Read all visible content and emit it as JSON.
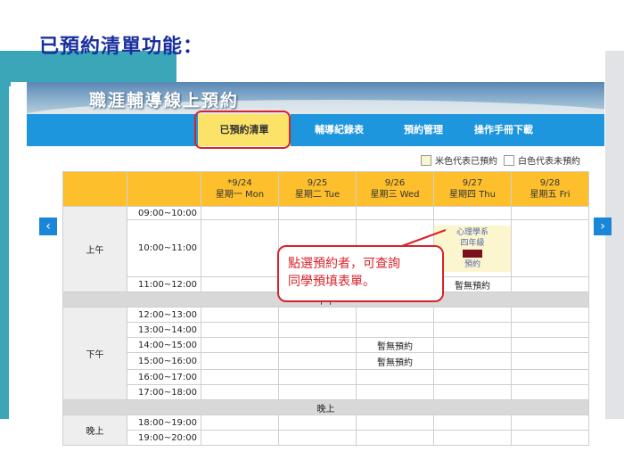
{
  "slide": {
    "title": "已預約清單功能："
  },
  "site": {
    "banner_title": "職涯輔導線上預約"
  },
  "nav": {
    "items": [
      {
        "label": "已預約清單"
      },
      {
        "label": "輔導紀錄表"
      },
      {
        "label": "預約管理"
      },
      {
        "label": "操作手冊下載"
      }
    ]
  },
  "legend": {
    "booked_label": "米色代表已預約",
    "free_label": "白色代表未預約",
    "booked_color": "#fcf6cf",
    "free_color": "#ffffff"
  },
  "accent_colors": {
    "nav": "#1e96de",
    "header": "#fdbf2c",
    "highlight": "#d9222a"
  },
  "schedule": {
    "headers": [
      {
        "date": "*9/24",
        "day": "星期一 Mon"
      },
      {
        "date": "9/25",
        "day": "星期二 Tue"
      },
      {
        "date": "9/26",
        "day": "星期三 Wed"
      },
      {
        "date": "9/27",
        "day": "星期四 Thu"
      },
      {
        "date": "9/28",
        "day": "星期五 Fri"
      }
    ],
    "periods": {
      "morning": "上午",
      "afternoon": "下午",
      "evening": "晚上"
    },
    "slots": [
      "09:00~10:00",
      "10:00~11:00",
      "11:00~12:00",
      "12:00~13:00",
      "13:00~14:00",
      "14:00~15:00",
      "15:00~16:00",
      "16:00~17:00",
      "17:00~18:00",
      "18:00~19:00",
      "19:00~20:00"
    ],
    "breaks": {
      "noon": "中午",
      "evening": "晚上"
    },
    "booking": {
      "dept": "心理學系",
      "grade": "四年級",
      "status": "預約"
    },
    "no_booking": "暫無預約"
  },
  "icons": {
    "prev": "chevron-left-icon",
    "next": "chevron-right-icon"
  },
  "arrows": {
    "prev": "‹",
    "next": "›"
  },
  "callout": {
    "line1": "點選預約者，可查詢",
    "line2": "同學預填表單。"
  }
}
